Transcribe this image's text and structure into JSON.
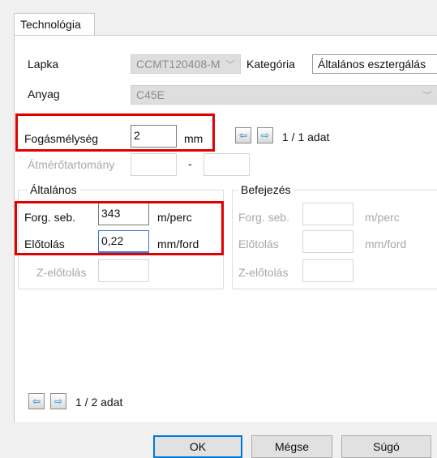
{
  "tabs": [
    {
      "label": "Technológia",
      "active": true
    }
  ],
  "technology": {
    "insert_label": "Lapka",
    "insert_value": "CCMT120408-M",
    "category_label": "Kategória",
    "category_value": "Általános esztergálás",
    "material_label": "Anyag",
    "material_value": "C45E",
    "depth_label": "Fogásmélység",
    "depth_value": "2",
    "depth_unit": "mm",
    "depth_navigation": "1 / 1 adat",
    "diameter_range_label": "Átmérőtartomány",
    "diameter_range_separator": "-"
  },
  "general": {
    "title": "Általános",
    "cutting_speed_label": "Forg. seb.",
    "cutting_speed_value": "343",
    "cutting_speed_unit": "m/perc",
    "feed_label": "Előtolás",
    "feed_value": "0,22",
    "feed_unit": "mm/ford",
    "z_feed_label": "Z-előtolás",
    "z_feed_value": ""
  },
  "finishing": {
    "title": "Befejezés",
    "cutting_speed_label": "Forg. seb.",
    "cutting_speed_value": "",
    "cutting_speed_unit": "m/perc",
    "feed_label": "Előtolás",
    "feed_value": "",
    "feed_unit": "mm/ford",
    "z_feed_label": "Z-előtolás",
    "z_feed_value": ""
  },
  "navigation": {
    "records": "1 / 2 adat",
    "prev_icon": "left-arrow-icon",
    "next_icon": "right-arrow-icon"
  },
  "footer": {
    "ok_label": "OK",
    "cancel_label": "Mégse",
    "help_label": "Súgó"
  },
  "colors": {
    "highlight": "#e00000",
    "focus": "#3979d7",
    "nav_arrow": "#0d7bd4"
  }
}
